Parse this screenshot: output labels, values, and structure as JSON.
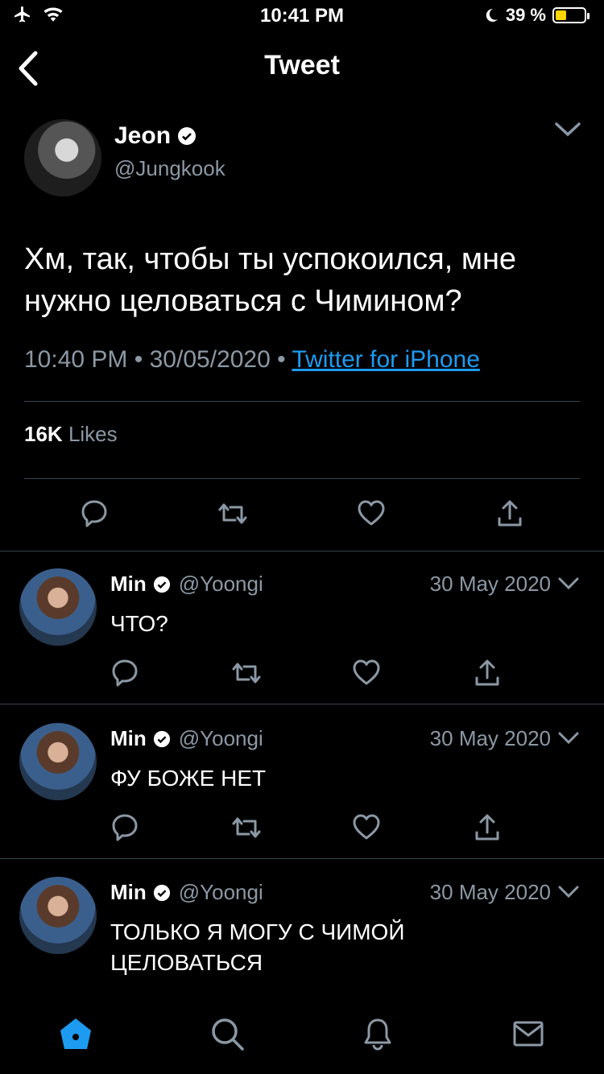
{
  "status_bar": {
    "time": "10:41 PM",
    "battery": "39 %",
    "battery_level": 0.39
  },
  "header": {
    "title": "Tweet"
  },
  "main_tweet": {
    "name": "Jeon",
    "handle": "@Jungkook",
    "text": "Хм, так, чтобы ты успокоился, мне нужно целоваться с Чимином?",
    "time": "10:40 PM",
    "date": "30/05/2020",
    "separator": "•",
    "source": "Twitter for iPhone",
    "likes_count": "16K",
    "likes_label": "Likes"
  },
  "replies": [
    {
      "name": "Min",
      "handle": "@Yoongi",
      "date": "30 May 2020",
      "text": "ЧТО?"
    },
    {
      "name": "Min",
      "handle": "@Yoongi",
      "date": "30 May 2020",
      "text": "ФУ БОЖЕ НЕТ"
    },
    {
      "name": "Min",
      "handle": "@Yoongi",
      "date": "30 May 2020",
      "text": "ТОЛЬКО Я МОГУ С ЧИМОЙ ЦЕЛОВАТЬСЯ"
    }
  ],
  "colors": {
    "accent": "#1d9bf0",
    "muted": "#8b98a5",
    "divider": "#38444d",
    "battery": "#ffd500"
  },
  "icons": [
    "airplane-icon",
    "wifi-icon",
    "moon-icon",
    "battery-icon",
    "back-chevron-icon",
    "verified-icon",
    "chevron-down-icon",
    "reply-icon",
    "retweet-icon",
    "like-icon",
    "share-icon",
    "home-icon",
    "search-icon",
    "notifications-icon",
    "messages-icon"
  ]
}
